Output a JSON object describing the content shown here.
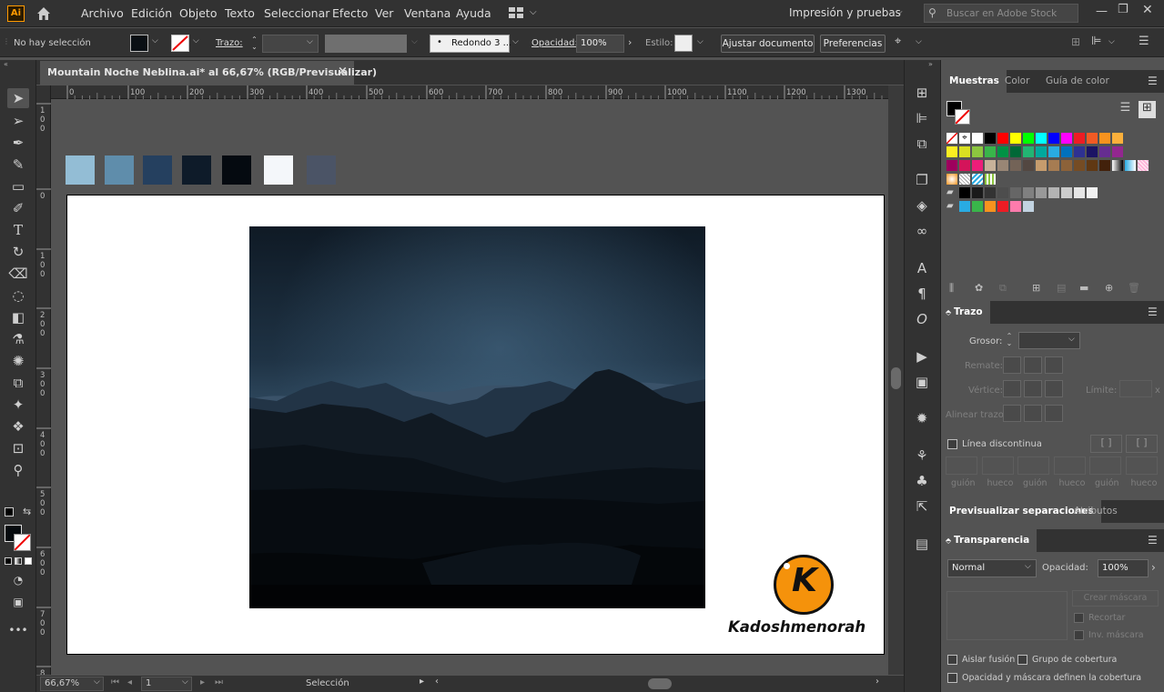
{
  "app": {
    "logo": "Ai"
  },
  "menu": [
    "Archivo",
    "Edición",
    "Objeto",
    "Texto",
    "Seleccionar",
    "Efecto",
    "Ver",
    "Ventana",
    "Ayuda"
  ],
  "workspace": "Impresión y pruebas",
  "search": {
    "placeholder": "Buscar en Adobe Stock"
  },
  "control": {
    "selection": "No hay selección",
    "stroke_label": "Trazo:",
    "brush": "Redondo 3 ...",
    "opacity_label": "Opacidad:",
    "opacity_value": "100%",
    "style_label": "Estilo:",
    "fit_button": "Ajustar documento",
    "prefs_button": "Preferencias"
  },
  "document": {
    "tab_title": "Mountain Noche Neblina.ai* al 66,67% (RGB/Previsualizar)",
    "close": "×"
  },
  "ruler": {
    "h_ticks": [
      "0",
      "100",
      "200",
      "300",
      "400",
      "500",
      "600",
      "700",
      "800",
      "900",
      "1000",
      "1100",
      "1200",
      "1300"
    ],
    "v_ticks": [
      "100",
      "0",
      "100",
      "200",
      "300",
      "400",
      "500",
      "600",
      "700",
      "800"
    ]
  },
  "palette": {
    "colors": [
      "#93bdd5",
      "#5f8dab",
      "#25405f",
      "#0e1b29",
      "#050a10",
      "#f4f7fa",
      "#4b5466"
    ]
  },
  "watermark": {
    "letter": "K",
    "text": "Kadoshmenorah"
  },
  "status": {
    "zoom": "66,67%",
    "page": "1",
    "tool": "Selección"
  },
  "swatches_panel": {
    "tabs": [
      "Muestras",
      "Color",
      "Guía de color"
    ]
  },
  "stroke_panel": {
    "title": "Trazo",
    "weight_label": "Grosor:",
    "cap_label": "Remate:",
    "corner_label": "Vértice:",
    "limit_label": "Límite:",
    "limit_x": "x",
    "align_label": "Alinear trazo:",
    "dashed_label": "Línea discontinua",
    "dash_fields": [
      "guión",
      "hueco",
      "guión",
      "hueco",
      "guión",
      "hueco"
    ]
  },
  "separations_panel": {
    "tabs": [
      "Previsualizar separaciones",
      "Atributos"
    ]
  },
  "transparency_panel": {
    "title": "Transparencia",
    "mode": "Normal",
    "opacity_label": "Opacidad:",
    "opacity_value": "100%",
    "mask_button": "Crear máscara",
    "clip_label": "Recortar",
    "invert_label": "Inv. máscara",
    "isolate_label": "Aislar fusión",
    "knockout_label": "Grupo de cobertura",
    "opacity_mask_label": "Opacidad y máscara definen la cobertura"
  }
}
